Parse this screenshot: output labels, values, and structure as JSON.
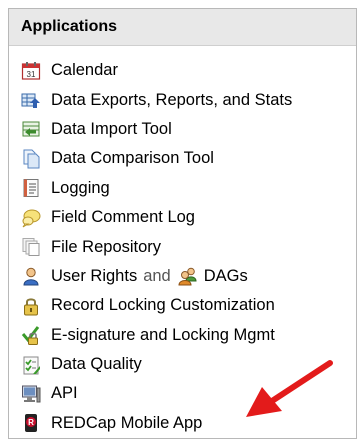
{
  "panel": {
    "title": "Applications"
  },
  "items": [
    {
      "label": "Calendar",
      "icon": "calendar-icon"
    },
    {
      "label": "Data Exports, Reports, and Stats",
      "icon": "data-export-icon"
    },
    {
      "label": "Data Import Tool",
      "icon": "data-import-icon"
    },
    {
      "label": "Data Comparison Tool",
      "icon": "data-comparison-icon"
    },
    {
      "label": "Logging",
      "icon": "logging-icon"
    },
    {
      "label": "Field Comment Log",
      "icon": "comment-log-icon"
    },
    {
      "label": "File Repository",
      "icon": "file-repository-icon"
    },
    {
      "label": "User Rights",
      "and": "and",
      "label2": "DAGs",
      "icon": "user-icon",
      "icon2": "users-group-icon"
    },
    {
      "label": "Record Locking Customization",
      "icon": "lock-icon"
    },
    {
      "label": "E-signature and Locking Mgmt",
      "icon": "esignature-icon"
    },
    {
      "label": "Data Quality",
      "icon": "checklist-icon"
    },
    {
      "label": "API",
      "icon": "api-icon"
    },
    {
      "label": "REDCap Mobile App",
      "icon": "redcap-mobile-icon"
    }
  ],
  "colors": {
    "header_bg": "#e8e8e8",
    "arrow": "#e31b1b"
  }
}
